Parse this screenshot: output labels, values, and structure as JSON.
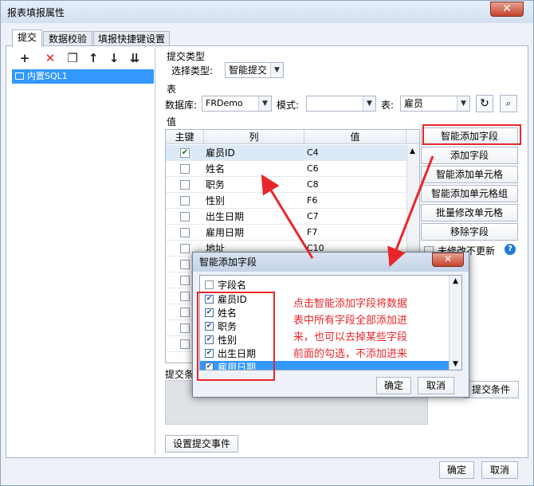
{
  "window": {
    "title": "报表填报属性",
    "close": "✕"
  },
  "tabs": [
    "提交",
    "数据校验",
    "填报快捷键设置"
  ],
  "left_pane": {
    "toolbar": [
      "+",
      "✕",
      "❐",
      "↑",
      "↓",
      "⇊"
    ],
    "tree_item": "内置SQL1"
  },
  "submit_type": {
    "group": "提交类型",
    "label": "选择类型:",
    "value": "智能提交"
  },
  "table_section": {
    "group": "表",
    "db_label": "数据库:",
    "db_value": "FRDemo",
    "schema_label": "模式:",
    "schema_value": "",
    "table_label": "表:",
    "table_value": "雇员"
  },
  "values_section": {
    "group": "值",
    "headers": [
      "主键",
      "列",
      "值"
    ],
    "rows": [
      {
        "key": true,
        "col": "雇员ID",
        "val": "C4"
      },
      {
        "key": false,
        "col": "姓名",
        "val": "C6"
      },
      {
        "key": false,
        "col": "职务",
        "val": "C8"
      },
      {
        "key": false,
        "col": "性别",
        "val": "F6"
      },
      {
        "key": false,
        "col": "出生日期",
        "val": "C7"
      },
      {
        "key": false,
        "col": "雇用日期",
        "val": "F7"
      },
      {
        "key": false,
        "col": "地址",
        "val": "C10"
      },
      {
        "key": false,
        "col": "",
        "val": ""
      },
      {
        "key": false,
        "col": "",
        "val": ""
      },
      {
        "key": false,
        "col": "",
        "val": ""
      },
      {
        "key": false,
        "col": "",
        "val": ""
      },
      {
        "key": false,
        "col": "",
        "val": ""
      },
      {
        "key": false,
        "col": "",
        "val": ""
      }
    ]
  },
  "side_buttons": [
    "智能添加字段",
    "添加字段",
    "智能添加单元格",
    "智能添加单元格组",
    "批量修改单元格",
    "移除字段"
  ],
  "unchanged_label": "未修改不更新",
  "submit_condition_label": "提交条",
  "submit_condition_btn": "提交条件",
  "set_event_btn": "设置提交事件",
  "footer": {
    "ok": "确定",
    "cancel": "取消"
  },
  "popup": {
    "title": "智能添加字段",
    "header": "字段名",
    "fields": [
      {
        "name": "雇员ID",
        "checked": true
      },
      {
        "name": "姓名",
        "checked": true
      },
      {
        "name": "职务",
        "checked": true
      },
      {
        "name": "性别",
        "checked": true
      },
      {
        "name": "出生日期",
        "checked": true
      },
      {
        "name": "雇用日期",
        "checked": true
      }
    ],
    "ok": "确定",
    "cancel": "取消"
  },
  "annotation": [
    "点击智能添加字段将数据",
    "表中所有字段全部添加进",
    "来，也可以去掉某些字段",
    "前面的勾选，不添加进来"
  ]
}
